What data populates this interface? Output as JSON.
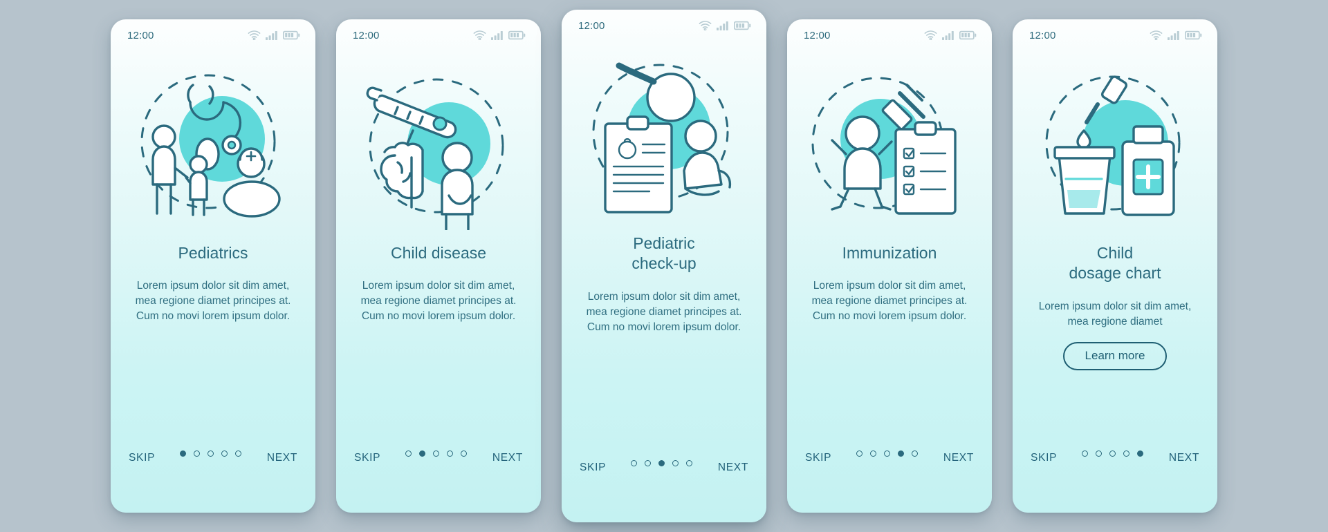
{
  "screen": {
    "background_color": "#b6c3cc",
    "accent_color": "#5fd9da",
    "text_color": "#2b6a7e",
    "card_gradient_top": "#fdfefe",
    "card_gradient_bottom": "#c4f2f2"
  },
  "status_bar": {
    "time": "12:00",
    "icons": [
      "wifi-icon",
      "cellular-signal-icon",
      "battery-icon"
    ]
  },
  "nav": {
    "skip_label": "SKIP",
    "next_label": "NEXT",
    "total_dots": 5
  },
  "screens": [
    {
      "id": "pediatrics",
      "illustration": "pediatrics-illustration",
      "title": "Pediatrics",
      "description": "Lorem ipsum dolor sit dim amet, mea regione diamet principes at. Cum no movi lorem ipsum dolor.",
      "active_dot": 1,
      "cta": null
    },
    {
      "id": "child-disease",
      "illustration": "child-disease-illustration",
      "title": "Child disease",
      "description": "Lorem ipsum dolor sit dim amet, mea regione diamet principes at. Cum no movi lorem ipsum dolor.",
      "active_dot": 2,
      "cta": null
    },
    {
      "id": "pediatric-check-up",
      "illustration": "pediatric-checkup-illustration",
      "title": "Pediatric\ncheck-up",
      "description": "Lorem ipsum dolor sit dim amet, mea regione diamet principes at. Cum no movi lorem ipsum dolor.",
      "active_dot": 3,
      "cta": null
    },
    {
      "id": "immunization",
      "illustration": "immunization-illustration",
      "title": "Immunization",
      "description": "Lorem ipsum dolor sit dim amet, mea regione diamet principes at. Cum no movi lorem ipsum dolor.",
      "active_dot": 4,
      "cta": null
    },
    {
      "id": "child-dosage-chart",
      "illustration": "child-dosage-chart-illustration",
      "title": "Child\ndosage chart",
      "description": "Lorem ipsum dolor sit dim amet, mea regione diamet",
      "active_dot": 5,
      "cta": "Learn more"
    }
  ]
}
